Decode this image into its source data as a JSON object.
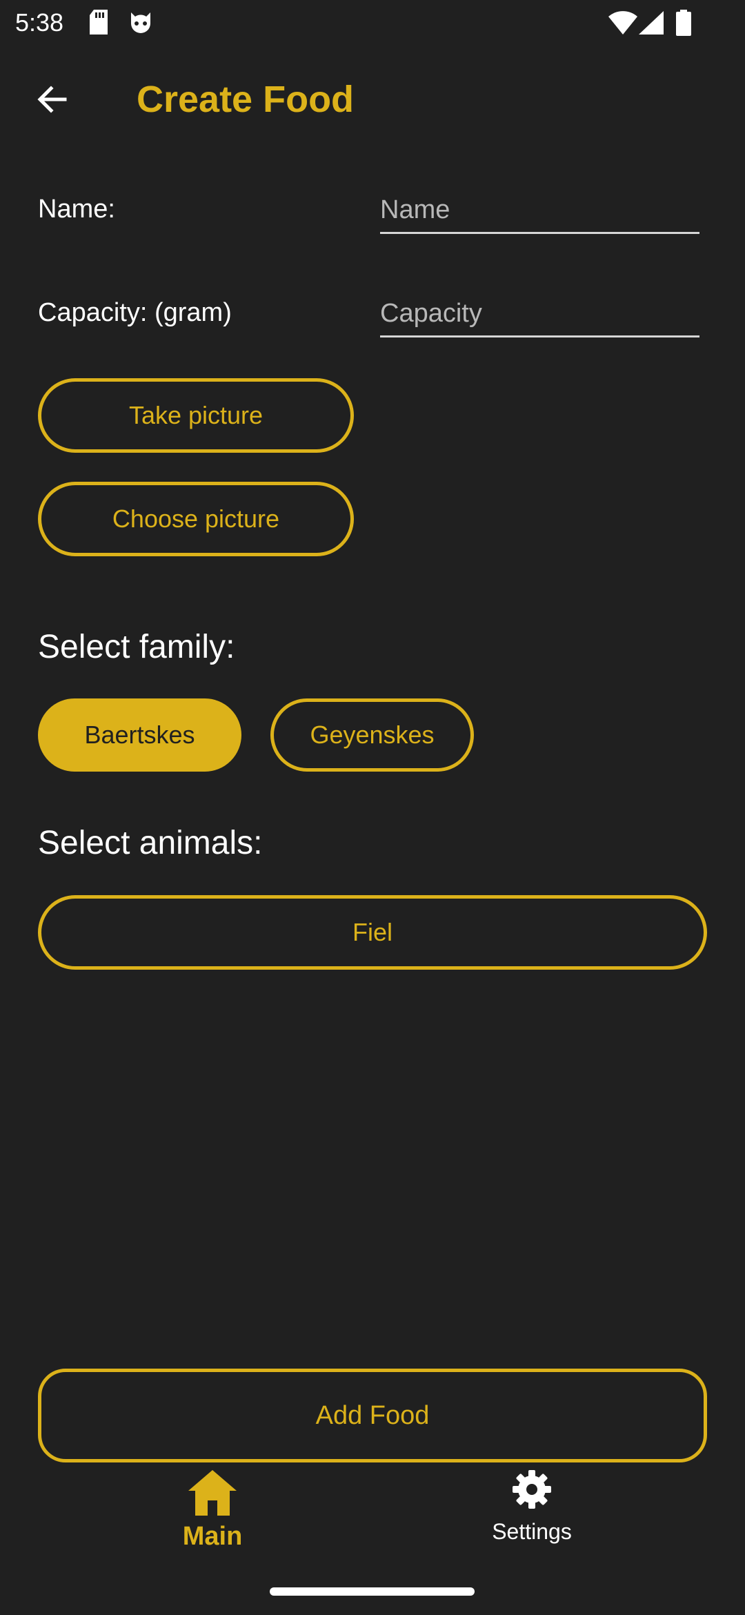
{
  "status_bar": {
    "time": "5:38",
    "icons": [
      "sd-card-icon",
      "cat-face-icon",
      "wifi-icon",
      "signal-icon",
      "battery-icon"
    ]
  },
  "app_bar": {
    "title": "Create Food",
    "back_icon": "arrow-left-icon"
  },
  "form": {
    "name_label": "Name:",
    "name_placeholder": "Name",
    "name_value": "",
    "capacity_label": "Capacity: (gram)",
    "capacity_placeholder": "Capacity",
    "capacity_value": "",
    "take_picture_label": "Take picture",
    "choose_picture_label": "Choose picture"
  },
  "family": {
    "title": "Select family:",
    "options": [
      {
        "label": "Baertskes",
        "selected": true
      },
      {
        "label": "Geyenskes",
        "selected": false
      }
    ]
  },
  "animals": {
    "title": "Select animals:",
    "options": [
      {
        "label": "Fiel",
        "selected": false
      }
    ]
  },
  "actions": {
    "add_food_label": "Add Food"
  },
  "bottom_nav": {
    "items": [
      {
        "label": "Main",
        "icon": "home-icon",
        "active": true
      },
      {
        "label": "Settings",
        "icon": "gear-icon",
        "active": false
      }
    ]
  },
  "colors": {
    "accent": "#dcb21a",
    "background": "#202020",
    "text": "#ffffff"
  }
}
